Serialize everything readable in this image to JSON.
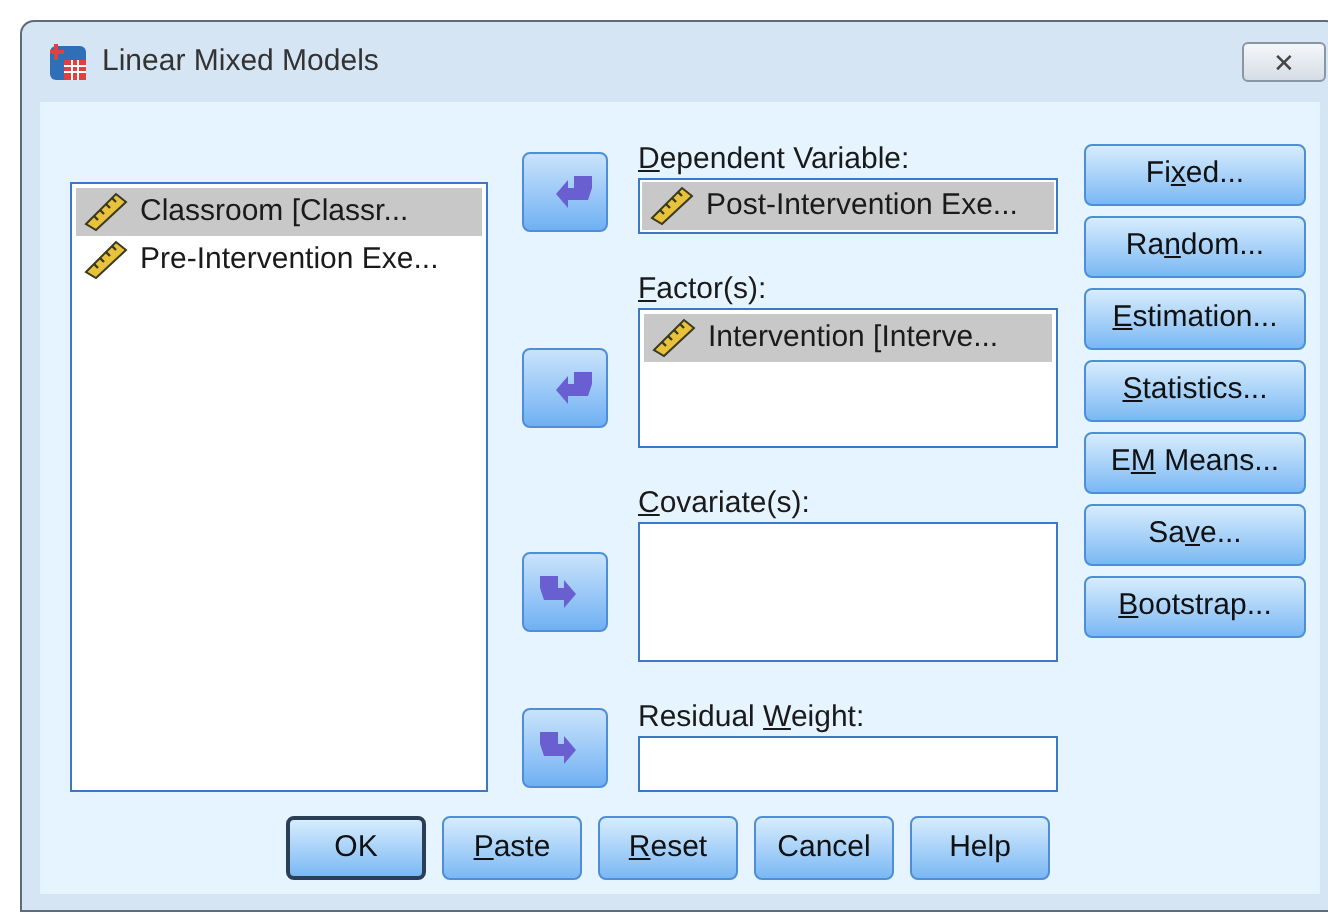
{
  "window": {
    "title": "Linear Mixed Models",
    "close": "✕"
  },
  "variables": [
    {
      "label": "Classroom [Classr...",
      "selected": true
    },
    {
      "label": "Pre-Intervention Exe...",
      "selected": false
    }
  ],
  "arrows": [
    {
      "kind": "left"
    },
    {
      "kind": "left"
    },
    {
      "kind": "right"
    },
    {
      "kind": "right"
    }
  ],
  "targets": [
    {
      "kind": "single",
      "label": [
        {
          "text": "D",
          "underline": true
        },
        {
          "text": "ependent Variable:",
          "underline": false
        }
      ],
      "items": [
        {
          "label": "Post-Intervention Exe...",
          "selected": true
        }
      ]
    },
    {
      "kind": "list",
      "label": [
        {
          "text": "F",
          "underline": true
        },
        {
          "text": "actor(s):",
          "underline": false
        }
      ],
      "items": [
        {
          "label": "Intervention [Interve...",
          "selected": true
        }
      ]
    },
    {
      "kind": "list",
      "label": [
        {
          "text": "C",
          "underline": true
        },
        {
          "text": "ovariate(s):",
          "underline": false
        }
      ]
    },
    {
      "kind": "single",
      "label": [
        {
          "text": "Residual ",
          "underline": false
        },
        {
          "text": "W",
          "underline": true
        },
        {
          "text": "eight:",
          "underline": false
        }
      ]
    }
  ],
  "side_buttons": [
    {
      "label": [
        {
          "text": "Fi",
          "underline": false
        },
        {
          "text": "x",
          "underline": true
        },
        {
          "text": "ed...",
          "underline": false
        }
      ]
    },
    {
      "label": [
        {
          "text": "Ra",
          "underline": false
        },
        {
          "text": "n",
          "underline": true
        },
        {
          "text": "dom...",
          "underline": false
        }
      ]
    },
    {
      "label": [
        {
          "text": "E",
          "underline": true
        },
        {
          "text": "stimation...",
          "underline": false
        }
      ]
    },
    {
      "label": [
        {
          "text": "S",
          "underline": true
        },
        {
          "text": "tatistics...",
          "underline": false
        }
      ]
    },
    {
      "label": [
        {
          "text": "E",
          "underline": false
        },
        {
          "text": "M",
          "underline": true
        },
        {
          "text": " Means...",
          "underline": false
        }
      ]
    },
    {
      "label": [
        {
          "text": "Sa",
          "underline": false
        },
        {
          "text": "v",
          "underline": true
        },
        {
          "text": "e...",
          "underline": false
        }
      ]
    },
    {
      "label": [
        {
          "text": "B",
          "underline": true
        },
        {
          "text": "ootstrap...",
          "underline": false
        }
      ]
    }
  ],
  "bottom_buttons": [
    {
      "default": true,
      "label": [
        {
          "text": "OK",
          "underline": false
        }
      ]
    },
    {
      "default": false,
      "label": [
        {
          "text": "P",
          "underline": true
        },
        {
          "text": "aste",
          "underline": false
        }
      ]
    },
    {
      "default": false,
      "label": [
        {
          "text": "R",
          "underline": true
        },
        {
          "text": "eset",
          "underline": false
        }
      ]
    },
    {
      "default": false,
      "label": [
        {
          "text": "Cancel",
          "underline": false
        }
      ]
    },
    {
      "default": false,
      "label": [
        {
          "text": "Help",
          "underline": false
        }
      ]
    }
  ]
}
